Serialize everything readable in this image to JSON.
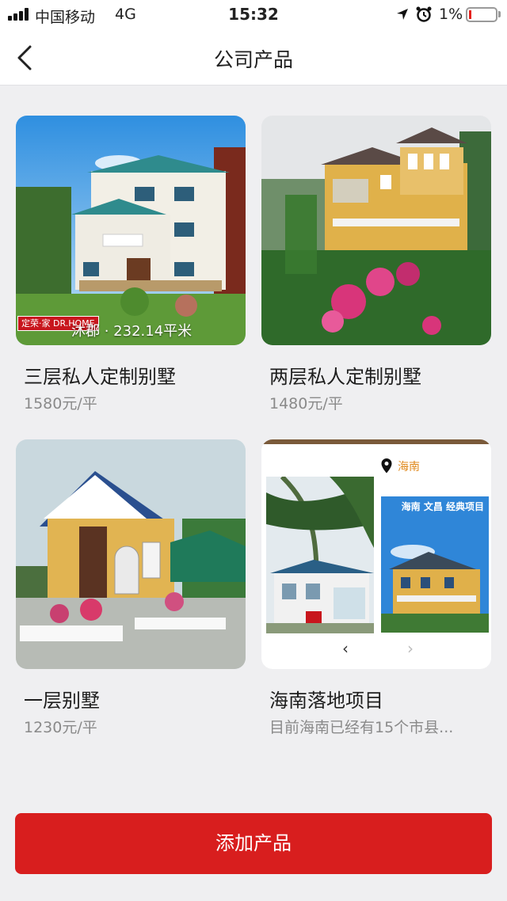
{
  "status_bar": {
    "carrier": "中国移动",
    "network": "4G",
    "time": "15:32",
    "battery_percent": "1%",
    "battery_level": 0.01,
    "icons": [
      "signal-icon",
      "location-arrow-icon",
      "alarm-icon",
      "battery-icon"
    ]
  },
  "navbar": {
    "title": "公司产品",
    "back_icon": "chevron-left-icon"
  },
  "products": [
    {
      "title": "三层私人定制别墅",
      "subtitle": "1580元/平",
      "image_badge": "定荣·家 DR.HOME",
      "image_caption": "沐郡 · 232.14平米"
    },
    {
      "title": "两层私人定制别墅",
      "subtitle": "1480元/平"
    },
    {
      "title": "一层别墅",
      "subtitle": "1230元/平"
    },
    {
      "title": "海南落地项目",
      "subtitle": "目前海南已经有15个市县...",
      "location_label": "海南",
      "corner_text": "海南 文昌 经典项目",
      "prev_icon": "chevron-left-icon",
      "next_icon": "chevron-right-icon",
      "prev_glyph": "‹",
      "next_glyph": "›"
    }
  ],
  "add_button": {
    "label": "添加产品"
  },
  "colors": {
    "accent_red": "#d81e1e",
    "background": "#efeff1",
    "subtitle_gray": "#8a8a8a",
    "location_orange": "#e08a1e"
  }
}
